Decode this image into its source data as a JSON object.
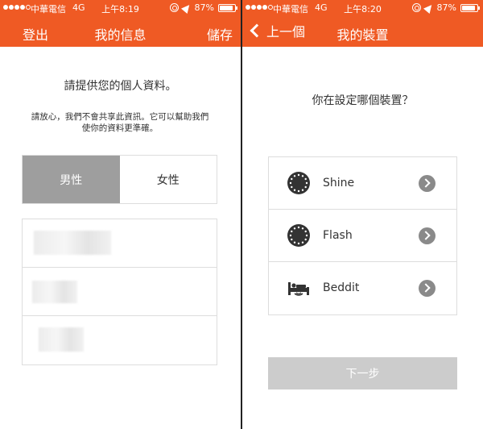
{
  "status_left": {
    "carrier": "中華電信",
    "network": "4G",
    "time": "上午8:19",
    "battery": "87%",
    "battery_level": 0.87
  },
  "status_right": {
    "carrier": "中華電信",
    "network": "4G",
    "time": "上午8:20",
    "battery": "87%",
    "battery_level": 0.87
  },
  "profile": {
    "nav": {
      "left_label": "登出",
      "title": "我的信息",
      "right_label": "儲存"
    },
    "prompt": "請提供您的個人資料。",
    "privacy_note": "請放心，我們不會共享此資訊。它可以幫助我們使你的資料更準確。",
    "gender": {
      "male": "男性",
      "female": "女性",
      "selected": "male"
    }
  },
  "devices": {
    "nav": {
      "back_label": "上一個",
      "title": "我的裝置"
    },
    "question": "你在設定哪個裝置？",
    "items": [
      {
        "label": "Shine",
        "icon": "shine-icon"
      },
      {
        "label": "Flash",
        "icon": "flash-icon"
      },
      {
        "label": "Beddit",
        "icon": "beddit-icon"
      }
    ],
    "next_label": "下一步"
  },
  "colors": {
    "accent": "#ef5a24",
    "selected_gray": "#9e9e9e",
    "disabled_gray": "#cccccc",
    "arrow_gray": "#8a8a8a"
  }
}
